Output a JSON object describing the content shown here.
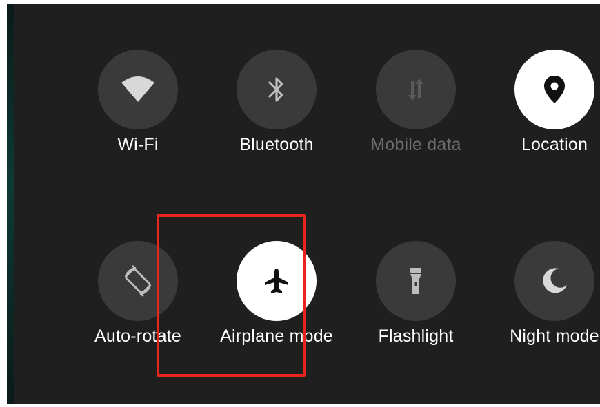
{
  "quick_settings": {
    "row1": [
      {
        "label": "Wi-Fi",
        "icon": "wifi-icon",
        "state": "off"
      },
      {
        "label": "Bluetooth",
        "icon": "bluetooth-icon",
        "state": "off"
      },
      {
        "label": "Mobile data",
        "icon": "mobile-data-icon",
        "state": "disabled"
      },
      {
        "label": "Location",
        "icon": "location-pin-icon",
        "state": "on"
      }
    ],
    "row2": [
      {
        "label": "Auto-rotate",
        "icon": "auto-rotate-icon",
        "state": "off"
      },
      {
        "label": "Airplane mode",
        "icon": "airplane-icon",
        "state": "on"
      },
      {
        "label": "Flashlight",
        "icon": "flashlight-icon",
        "state": "off"
      },
      {
        "label": "Night mode",
        "icon": "moon-icon",
        "state": "off"
      }
    ]
  },
  "colors": {
    "panel_background": "#1f1f1f",
    "tile_off": "#3a3a3a",
    "tile_on": "#ffffff",
    "label_text": "#ffffff",
    "label_disabled": "#6e6e6e",
    "highlight": "#e8261b"
  }
}
